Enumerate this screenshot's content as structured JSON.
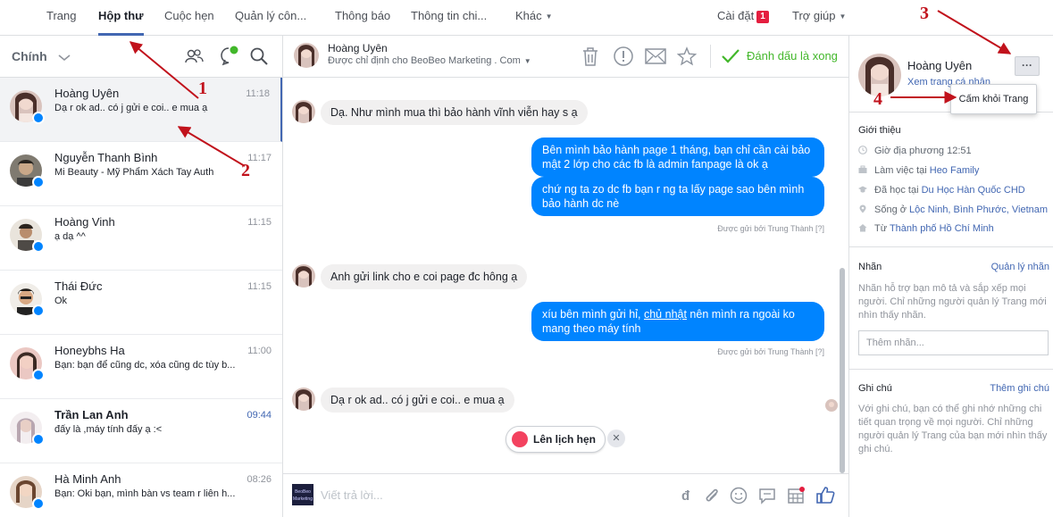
{
  "topnav": {
    "items": [
      "Trang",
      "Hộp thư",
      "Cuộc hẹn",
      "Quản lý côn...",
      "Thông báo",
      "Thông tin chi..."
    ],
    "more": "Khác",
    "settings": "Cài đặt",
    "settings_badge": "1",
    "help": "Trợ giúp"
  },
  "inbox": {
    "title": "Chính",
    "conversations": [
      {
        "name": "Hoàng Uyên",
        "preview": "Dạ r ok ad.. có j gửi e coi.. e mua ạ",
        "time": "11:18",
        "unread": false
      },
      {
        "name": "Nguyễn Thanh Bình",
        "preview": "Mi Beauty - Mỹ Phẩm Xách Tay Auth",
        "time": "11:17",
        "unread": false
      },
      {
        "name": "Hoàng Vinh",
        "preview": "ạ dạ ^^",
        "time": "11:15",
        "unread": false
      },
      {
        "name": "Thái Đức",
        "preview": "Ok",
        "time": "11:15",
        "unread": false
      },
      {
        "name": "Honeybhs Ha",
        "preview": "Bạn: bạn để cũng dc, xóa cũng dc tùy b...",
        "time": "11:00",
        "unread": false
      },
      {
        "name": "Trần Lan Anh",
        "preview": "đấy là ,máy tính đấy ạ :<",
        "time": "09:44",
        "unread": true
      },
      {
        "name": "Hà Minh Anh",
        "preview": "Bạn: Oki bạn, mình bàn vs team r liên h...",
        "time": "08:26",
        "unread": false
      }
    ]
  },
  "chat": {
    "name": "Hoàng Uyên",
    "assigned": "Được chỉ định cho BeoBeo Marketing . Com",
    "mark_done": "Đánh dấu là xong",
    "messages": {
      "in1": "Dạ. Như mình mua thì bảo hành vĩnh viễn hay s ạ",
      "out1": "Bên mình bảo hành page 1 tháng, bạn chỉ cần cài bảo mật 2 lớp cho các fb là admin fanpage là ok ạ",
      "out2": "chứ ng ta zo dc fb bạn r ng ta lấy page sao bên mình bảo hành dc nè",
      "sent1": "Được gửi bởi Trung Thành [?]",
      "in2": "Anh gửi link cho e coi page đc hông ạ",
      "out3_a": "xíu bên mình gửi hỉ, ",
      "out3_link": "chủ nhật",
      "out3_b": " nên mình ra ngoài ko mang theo máy tính",
      "sent2": "Được gửi bởi Trung Thành [?]",
      "in3": "Dạ r ok ad.. có j gửi e coi.. e mua ạ"
    },
    "schedule": "Lên lịch hẹn",
    "page_logo": "BeoBeo Marketing",
    "reply_placeholder": "Viết trả lời..."
  },
  "profile": {
    "name": "Hoàng Uyên",
    "view_link": "Xem trang cá nhân",
    "menu_item": "Cấm khỏi Trang",
    "intro_title": "Giới thiệu",
    "local_time": "Giờ địa phương 12:51",
    "work_prefix": "Làm việc tại ",
    "work": "Heo Family",
    "study_prefix": "Đã học tại ",
    "study": "Du Học Hàn Quốc CHD",
    "live_prefix": "Sống ở ",
    "live": "Lộc Ninh, Bình Phước, Vietnam",
    "from_prefix": "Từ ",
    "from": "Thành phố Hồ Chí Minh",
    "labels_title": "Nhãn",
    "labels_manage": "Quản lý nhãn",
    "labels_desc": "Nhãn hỗ trợ bạn mô tả và sắp xếp mọi người. Chỉ những người quản lý Trang mới nhìn thấy nhãn.",
    "labels_placeholder": "Thêm nhãn...",
    "notes_title": "Ghi chú",
    "notes_add": "Thêm ghi chú",
    "notes_desc": "Với ghi chú, bạn có thể ghi nhớ những chi tiết quan trọng về mọi người. Chỉ những người quản lý Trang của bạn mới nhìn thấy ghi chú."
  },
  "annotations": [
    "1",
    "2",
    "3",
    "4"
  ],
  "colors": {
    "accent": "#4267b2",
    "bubble_out": "#0084ff",
    "annotation": "#c1121c",
    "done": "#42b72a"
  }
}
